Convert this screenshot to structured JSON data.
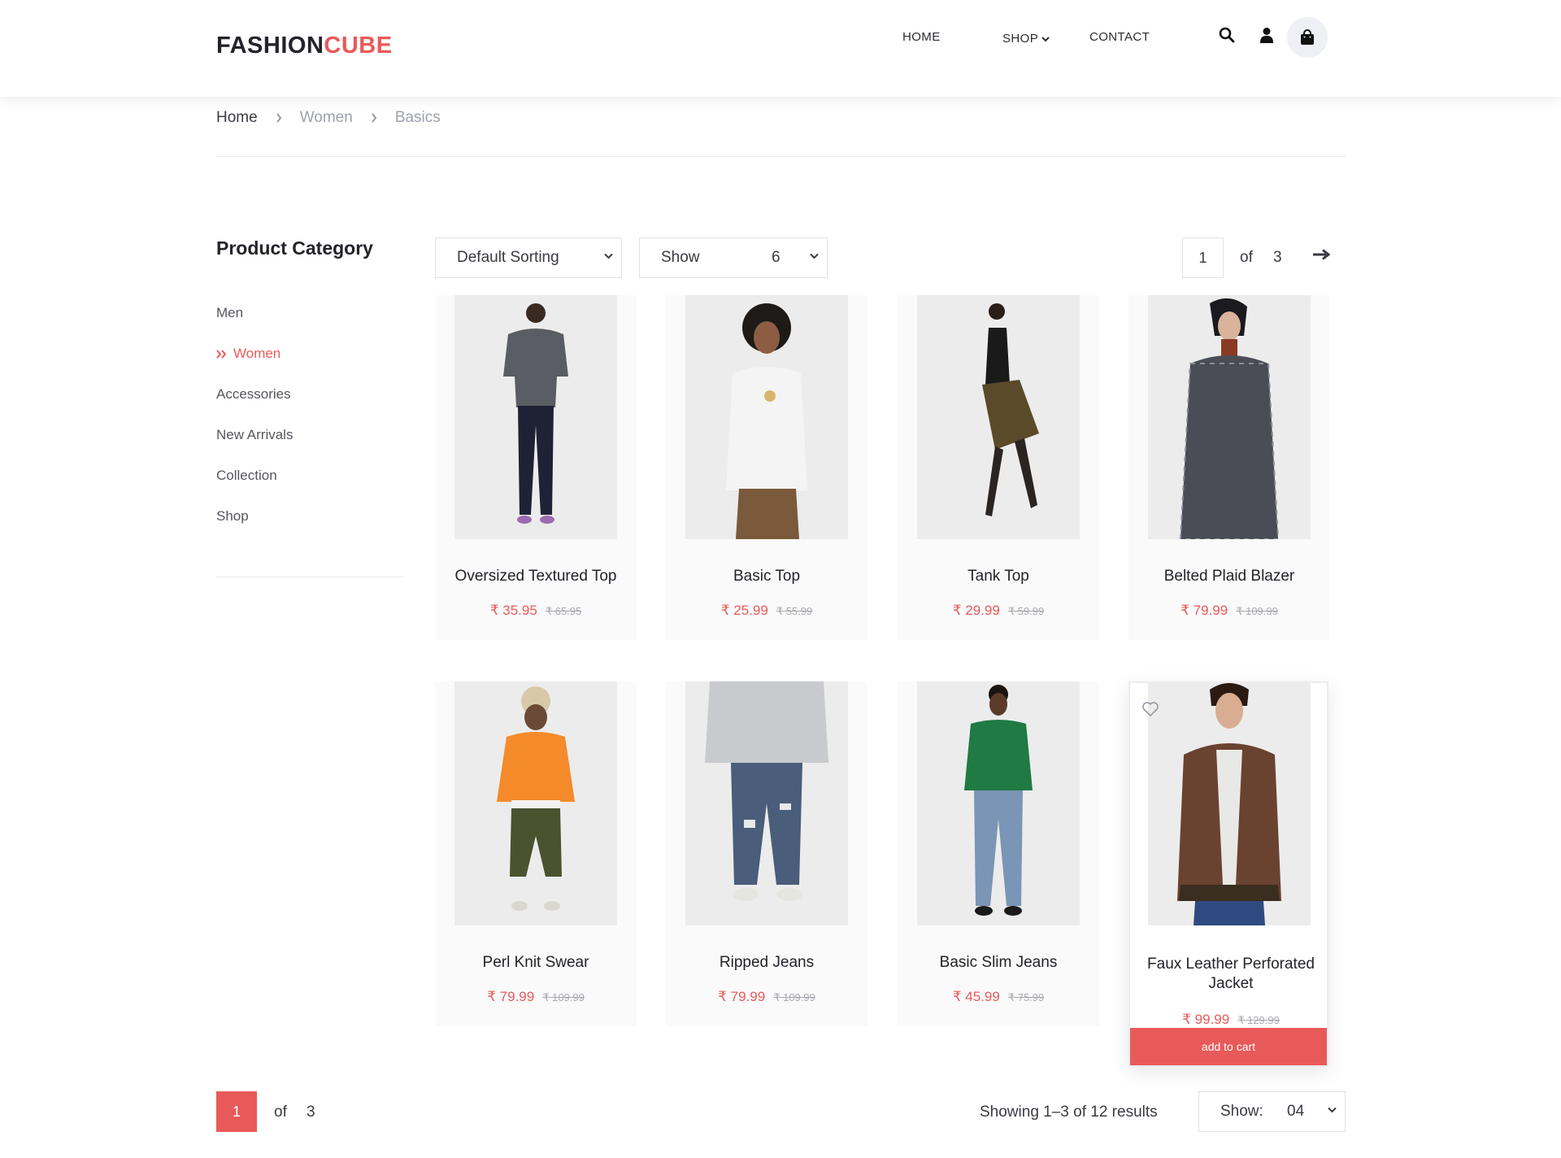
{
  "brand": {
    "part1": "FASHION",
    "part2": "CUBE",
    "accent": "#e85a5a"
  },
  "nav": {
    "home": "HOME",
    "shop": "SHOP",
    "contact": "CONTACT"
  },
  "header_icons": [
    "search-icon",
    "user-icon",
    "shopping-bag-icon"
  ],
  "breadcrumb": {
    "home": "Home",
    "women": "Women",
    "basics": "Basics"
  },
  "sidebar": {
    "title": "Product Category",
    "items": [
      {
        "label": "Men"
      },
      {
        "label": "Women",
        "active": true
      },
      {
        "label": "Accessories"
      },
      {
        "label": "New Arrivals"
      },
      {
        "label": "Collection"
      },
      {
        "label": "Shop"
      }
    ]
  },
  "toolbar": {
    "sort_label": "Default Sorting",
    "show_label": "Show",
    "show_value": "6",
    "page_current": "1",
    "page_of": "of",
    "page_total": "3"
  },
  "products": [
    {
      "name": "Oversized Textured Top",
      "price": "₹ 35.95",
      "old_price": "₹ 65.95"
    },
    {
      "name": "Basic Top",
      "price": "₹ 25.99",
      "old_price": "₹ 55.99"
    },
    {
      "name": "Tank Top",
      "price": "₹ 29.99",
      "old_price": "₹ 59.99"
    },
    {
      "name": "Belted Plaid Blazer",
      "price": "₹ 79.99",
      "old_price": "₹ 109.99"
    },
    {
      "name": "Perl Knit Swear",
      "price": "₹ 79.99",
      "old_price": "₹ 109.99"
    },
    {
      "name": "Ripped Jeans",
      "price": "₹ 79.99",
      "old_price": "₹ 109.99"
    },
    {
      "name": "Basic Slim Jeans",
      "price": "₹ 45.99",
      "old_price": "₹ 75.99"
    },
    {
      "name": "Faux Leather Perforated Jacket",
      "price": "₹ 99.99",
      "old_price": "₹ 129.99",
      "add_to_cart": "add to cart"
    }
  ],
  "bottom": {
    "page_current": "1",
    "page_of": "of",
    "page_total": "3",
    "results": "Showing 1–3 of 12 results",
    "show_label": "Show:",
    "show_value": "04"
  }
}
